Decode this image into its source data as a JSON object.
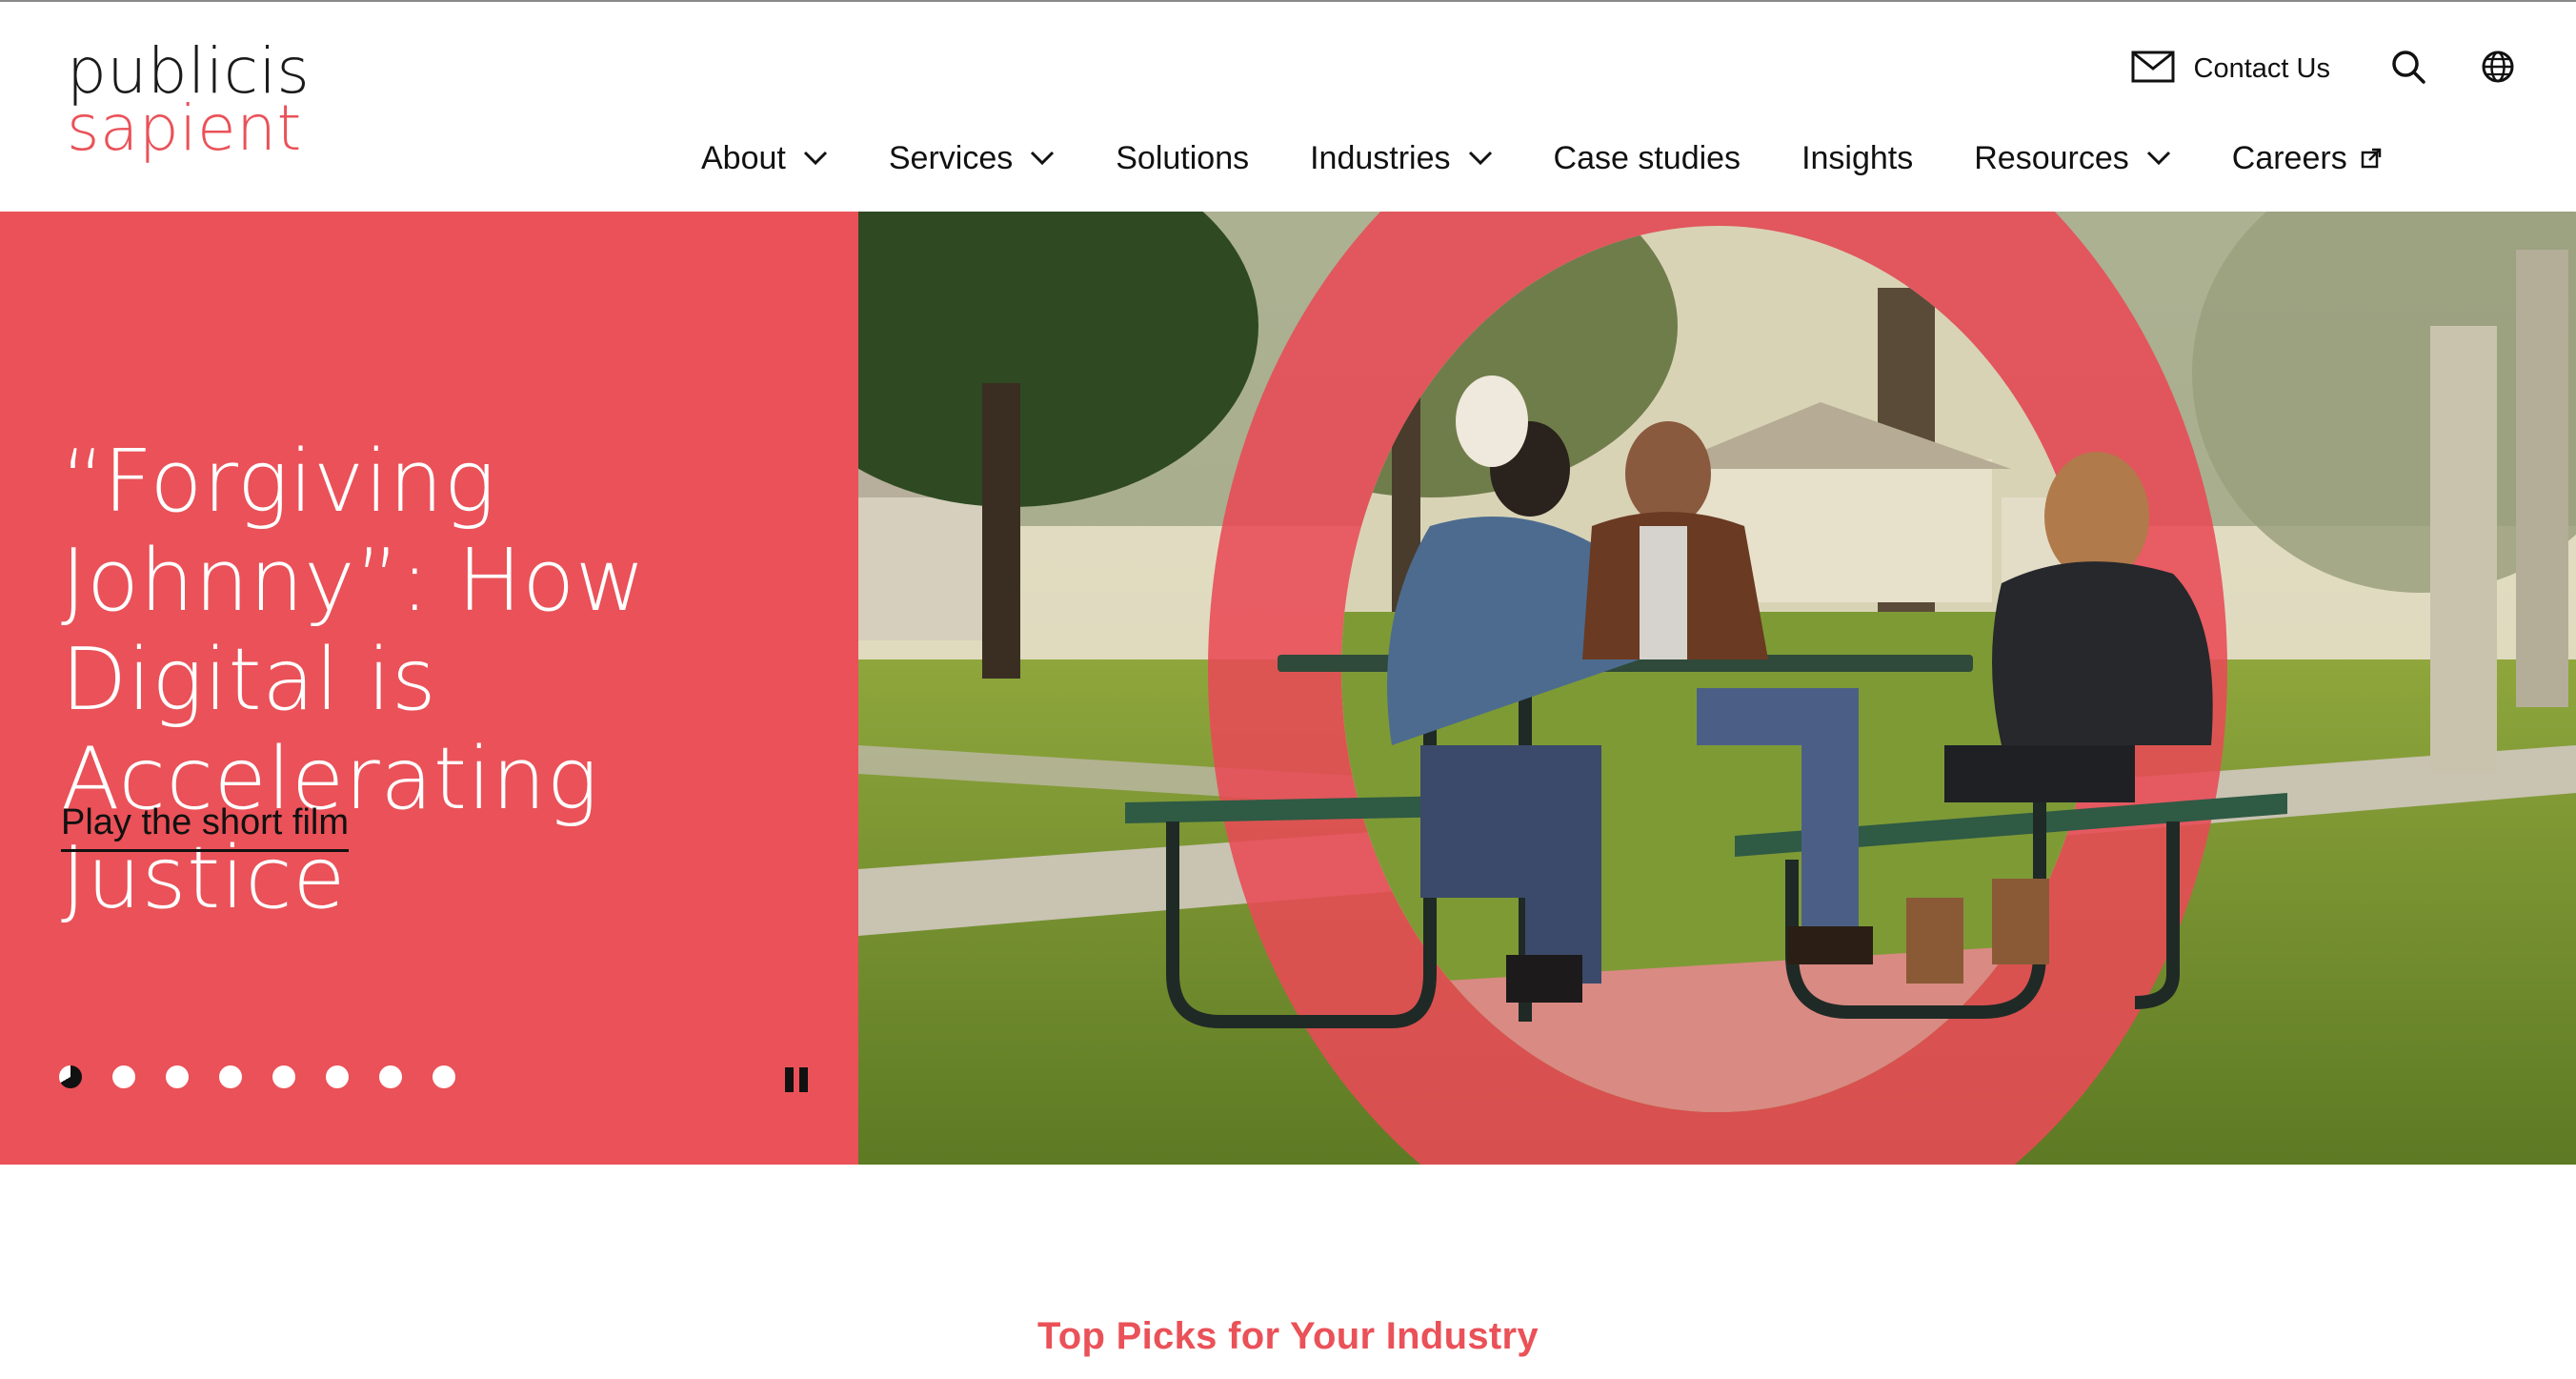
{
  "brand": {
    "line1": "publicis",
    "line2": "sapient",
    "accent_color": "#ea5158"
  },
  "utility": {
    "contact_label": "Contact Us",
    "contact_icon": "mail-icon",
    "search_icon": "search-icon",
    "language_icon": "globe-icon"
  },
  "nav": {
    "about": "About",
    "services": "Services",
    "solutions": "Solutions",
    "industries": "Industries",
    "case_studies": "Case studies",
    "insights": "Insights",
    "resources": "Resources",
    "careers": "Careers"
  },
  "hero": {
    "title": "“Forgiving Johnny”: How Digital is Accelerating Justice",
    "cta": "Play the short film",
    "slide_count": 8,
    "active_slide": 1,
    "pause_icon": "pause-icon",
    "image_icon": "photo-three-people-at-picnic-table"
  },
  "section": {
    "title": "Top Picks for Your Industry"
  }
}
